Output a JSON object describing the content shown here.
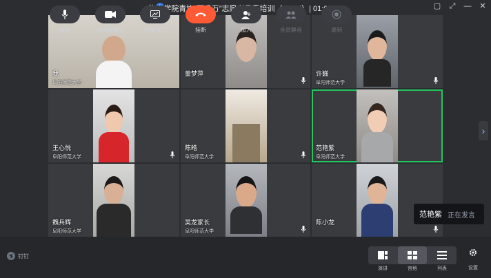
{
  "window": {
    "title": "物电学院青协“百千万”志愿者骨干培训（55/57）|  01:00:19"
  },
  "participants": [
    {
      "name": "我",
      "org": "阜阳师范大学",
      "mic": false,
      "active": false
    },
    {
      "name": "董梦萍",
      "org": "",
      "mic": true,
      "active": false
    },
    {
      "name": "许巍",
      "org": "阜阳师范大学",
      "mic": true,
      "active": false
    },
    {
      "name": "王心悦",
      "org": "阜阳师范大学",
      "mic": true,
      "active": false
    },
    {
      "name": "陈皓",
      "org": "阜阳师范大学",
      "mic": true,
      "active": false
    },
    {
      "name": "范艳紫",
      "org": "阜阳师范大学",
      "mic": false,
      "active": true
    },
    {
      "name": "魏兵辉",
      "org": "阜阳师范大学",
      "mic": false,
      "active": false
    },
    {
      "name": "吴龙家长",
      "org": "阜阳师范大学",
      "mic": true,
      "active": false
    },
    {
      "name": "陈小龙",
      "org": "",
      "mic": true,
      "active": false
    }
  ],
  "speaking_toast": {
    "name": "范艳紫",
    "status": "正在发言"
  },
  "app_logo": "钉钉",
  "toolbar": {
    "mute": "静音",
    "camera_off": "关闭摄像头",
    "share_window": "共享窗口",
    "hangup": "挂断",
    "add": "加入",
    "mute_all": "全员静音",
    "record": "录制",
    "view_speaker": "演讲",
    "view_gallery": "宫格",
    "view_list": "列表",
    "settings": "设置"
  },
  "colors": {
    "accent": "#22c55e",
    "hangup": "#ff5a36"
  }
}
